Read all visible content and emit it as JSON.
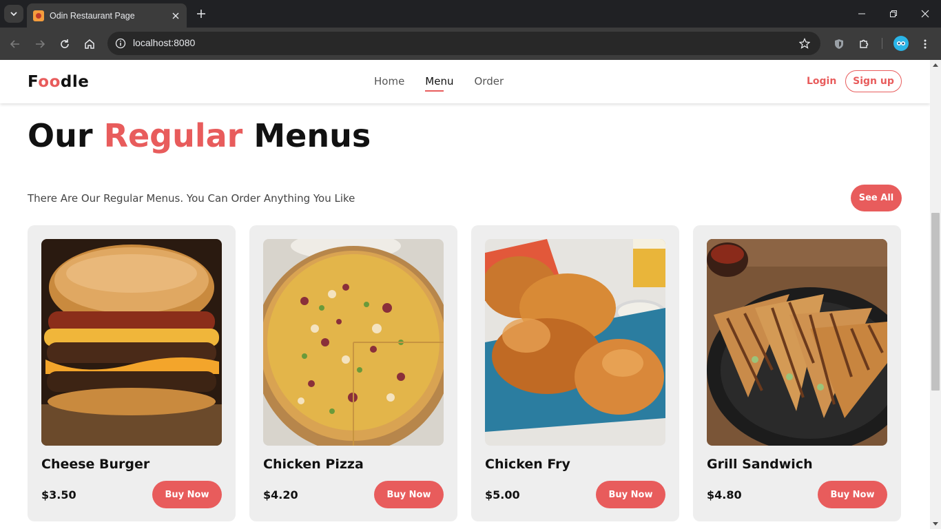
{
  "browser": {
    "tab_title": "Odin Restaurant Page",
    "url": "localhost:8080"
  },
  "site": {
    "logo_start": "F",
    "logo_accent": "oo",
    "logo_end": "dle",
    "nav": [
      {
        "label": "Home",
        "active": false
      },
      {
        "label": "Menu",
        "active": true
      },
      {
        "label": "Order",
        "active": false
      }
    ],
    "login": "Login",
    "signup": "Sign up"
  },
  "section": {
    "heading_start": "Our",
    "heading_accent": "Regular",
    "heading_end": "Menus",
    "subtitle": "There Are Our Regular Menus. You Can Order Anything You Like",
    "see_all": "See All"
  },
  "menu": [
    {
      "name": "Cheese Burger",
      "price": "$3.50",
      "button": "Buy Now",
      "image": "cheese-burger-photo"
    },
    {
      "name": "Chicken Pizza",
      "price": "$4.20",
      "button": "Buy Now",
      "image": "chicken-pizza-photo"
    },
    {
      "name": "Chicken Fry",
      "price": "$5.00",
      "button": "Buy Now",
      "image": "chicken-fry-photo"
    },
    {
      "name": "Grill Sandwich",
      "price": "$4.80",
      "button": "Buy Now",
      "image": "grill-sandwich-photo"
    }
  ],
  "colors": {
    "accent": "#e85c5c",
    "card_bg": "#eeeeee",
    "chrome_dark": "#202124",
    "chrome_toolbar": "#3c3c3c"
  }
}
